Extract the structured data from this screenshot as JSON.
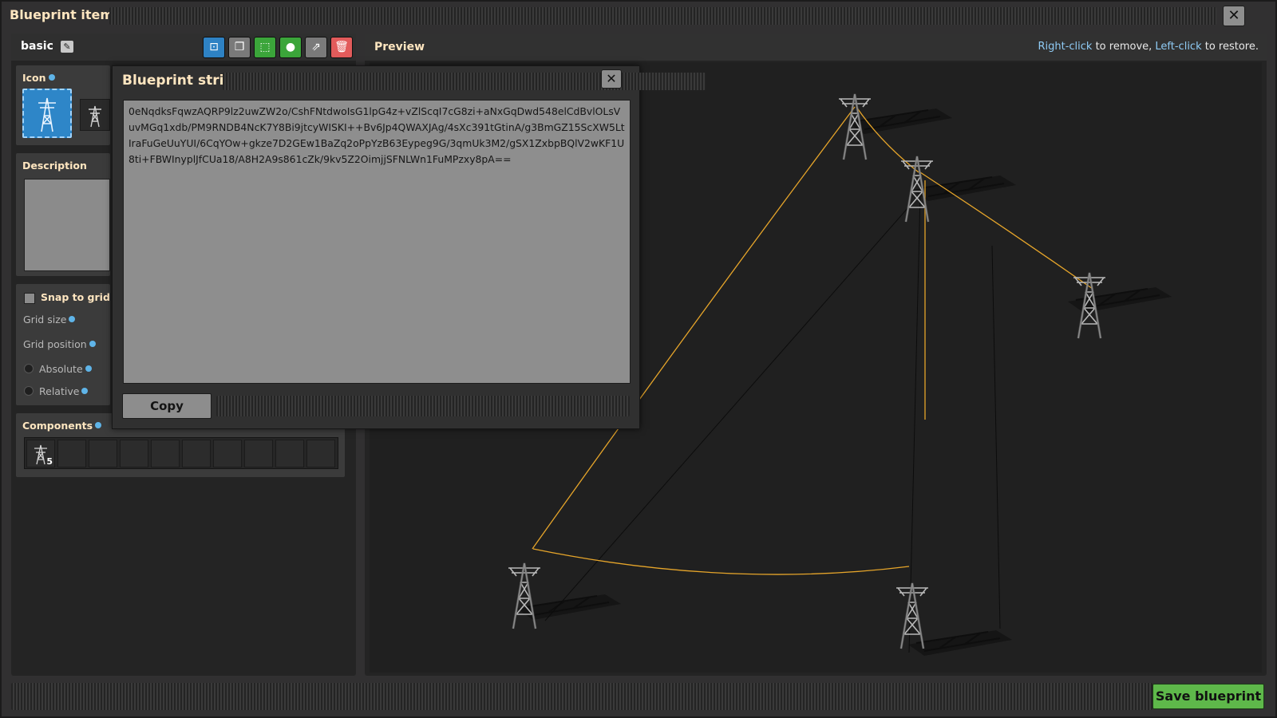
{
  "window": {
    "title": "Blueprint item",
    "close_glyph": "✕"
  },
  "toolbar": {
    "blueprint_name": "basic",
    "edit_glyph": "✎",
    "buttons": [
      {
        "name": "select-area-icon",
        "glyph": "⊡",
        "color": "#2e82c4"
      },
      {
        "name": "duplicate-icon",
        "glyph": "❐",
        "color": "#7a7a7a"
      },
      {
        "name": "reassign-area-icon",
        "glyph": "⬚",
        "color": "#3ba53a"
      },
      {
        "name": "blueprint-book-icon",
        "glyph": "●",
        "color": "#3ba53a"
      },
      {
        "name": "export-icon",
        "glyph": "⇗",
        "color": "#7a7a7a"
      },
      {
        "name": "delete-icon",
        "glyph": "🗑",
        "color": "#e25b5b"
      }
    ]
  },
  "left": {
    "icon_label": "Icon",
    "description_label": "Description",
    "snap_to_grid_label": "Snap to grid",
    "grid_size_label": "Grid size",
    "grid_position_label": "Grid position",
    "absolute_label": "Absolute",
    "relative_label": "Relative",
    "components_label": "Components",
    "component_count": "5"
  },
  "preview": {
    "title": "Preview",
    "hint_right_click": "Right-click",
    "hint_remove": " to remove, ",
    "hint_left_click": "Left-click",
    "hint_restore": " to restore."
  },
  "modal": {
    "title": "Blueprint string",
    "blueprint_string": "0eNqdksFqwzAQRP9lz2uwZW2o/CshFNtdwoIsG1lpG4z+vZlScqI7cG8zi+aNxGqDwd548elCdBvlOLsVuvMGq1xdb/PM9RNDB4NcK7Y8Bi9jtcyWISKI++Bv6Jp4QWAXJAg/4sXc391tGtinA/g3BmGZ15ScXW5LtIraFuGeUuYUI/6CqYOw+gkze7D2GEw1BaZq2oPpYzB63Eypeg9G/3qmUk3M2/gSX1ZxbpBQlV2wKF1U8ti+FBWInyplJfCUa18/A8H2A9s861cZk/9kv5Z2OimjjSFNLWn1FuMPzxy8pA==",
    "copy_label": "Copy"
  },
  "footer": {
    "save_label": "Save blueprint"
  },
  "colors": {
    "accent_green": "#5eb84a",
    "wire_orange": "#e6a52a",
    "hint_blue": "#8fcbf5"
  }
}
